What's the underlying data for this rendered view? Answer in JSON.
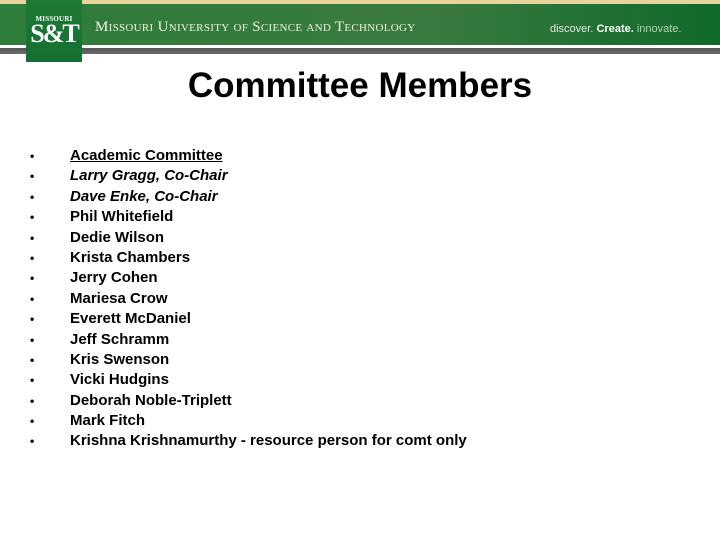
{
  "header": {
    "logo_small": "MISSOURI",
    "logo_big": "S&T",
    "university_name": "Missouri University of Science and Technology",
    "tagline": {
      "part1": "discover.",
      "part2": "Create.",
      "part3": "innovate."
    },
    "colors": {
      "green": "#2e7d3a",
      "tan": "#e8d49a",
      "gray": "#5f5f5f"
    }
  },
  "slide": {
    "title": "Committee Members",
    "bullet_glyph": "•",
    "items": [
      {
        "text": "Academic Committee",
        "style": "heading"
      },
      {
        "text": "Larry Gragg, Co-Chair",
        "style": "italic"
      },
      {
        "text": "Dave Enke, Co-Chair",
        "style": "italic"
      },
      {
        "text": "Phil Whitefield",
        "style": "normal"
      },
      {
        "text": "Dedie Wilson",
        "style": "normal"
      },
      {
        "text": "Krista Chambers",
        "style": "normal"
      },
      {
        "text": "Jerry Cohen",
        "style": "normal"
      },
      {
        "text": "Mariesa Crow",
        "style": "normal"
      },
      {
        "text": "Everett McDaniel",
        "style": "normal"
      },
      {
        "text": "Jeff Schramm",
        "style": "normal"
      },
      {
        "text": "Kris Swenson",
        "style": "normal"
      },
      {
        "text": "Vicki Hudgins",
        "style": "normal"
      },
      {
        "text": "Deborah Noble-Triplett",
        "style": "normal"
      },
      {
        "text": "Mark Fitch",
        "style": "normal"
      },
      {
        "text": "Krishna Krishnamurthy - resource person for comt only",
        "style": "normal"
      }
    ]
  }
}
